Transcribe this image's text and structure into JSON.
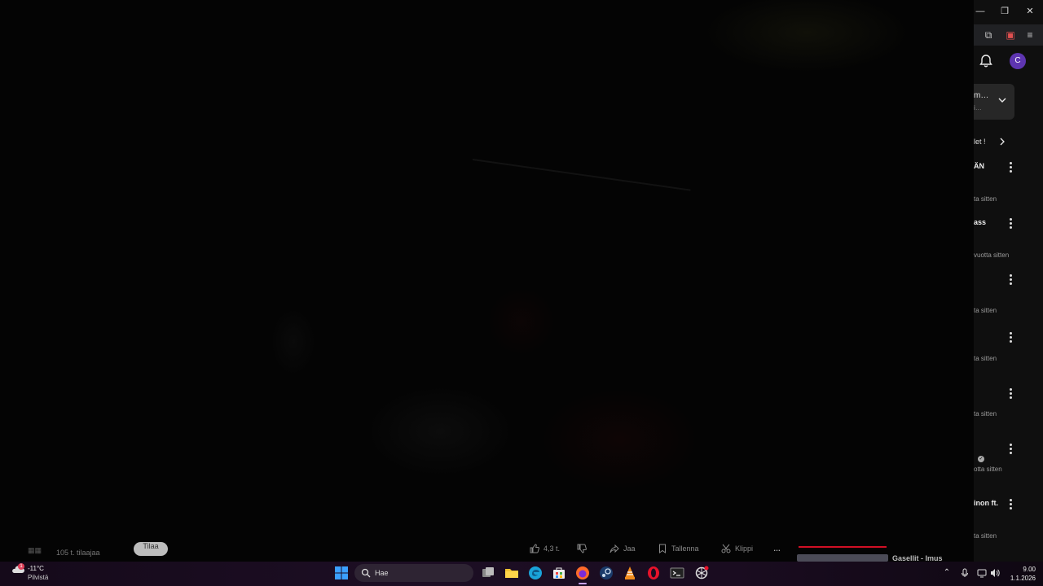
{
  "player": {
    "subscribers": "105 t. tilaajaa",
    "subscribe_label": "Tilaa",
    "like_count": "4,3 t.",
    "share_label": "Jaa",
    "save_label": "Tallenna",
    "clip_label": "Klippi",
    "more_label": "…",
    "next_title": "Gasellit - Imus",
    "progress_color": "#d10f25"
  },
  "window": {
    "minimize": "—",
    "maximize": "❐",
    "close": "✕"
  },
  "sidebar": {
    "avatar_letter": "C",
    "chat": {
      "title": "m…",
      "subtitle": "i…"
    },
    "filter_label": "let !",
    "items": [
      {
        "title": "ÄN",
        "meta": "ta sitten"
      },
      {
        "title": "ass",
        "meta": "vuotta sitten"
      },
      {
        "title": "",
        "meta": "ta sitten"
      },
      {
        "title": "",
        "meta": "ta sitten"
      },
      {
        "title": "",
        "meta": "ta sitten"
      },
      {
        "title": "",
        "meta": "otta sitten"
      },
      {
        "title": "inon ft.",
        "meta": "ta sitten"
      }
    ]
  },
  "taskbar": {
    "weather_temp": "-11°C",
    "weather_desc": "Pilvistä",
    "weather_badge": "1",
    "search_placeholder": "Hae",
    "time": "9.00",
    "date": "1.1.2026",
    "accent_color": "#c9a4ff"
  },
  "icons": [
    "windows-start-icon",
    "search-icon",
    "task-view-icon",
    "file-explorer-icon",
    "edge-icon",
    "store-icon",
    "firefox-icon",
    "steam-icon",
    "vlc-icon",
    "opera-icon",
    "terminal-icon",
    "chatgpt-icon",
    "chevron-up-icon",
    "microphone-icon",
    "speaker-icon",
    "network-icon"
  ]
}
